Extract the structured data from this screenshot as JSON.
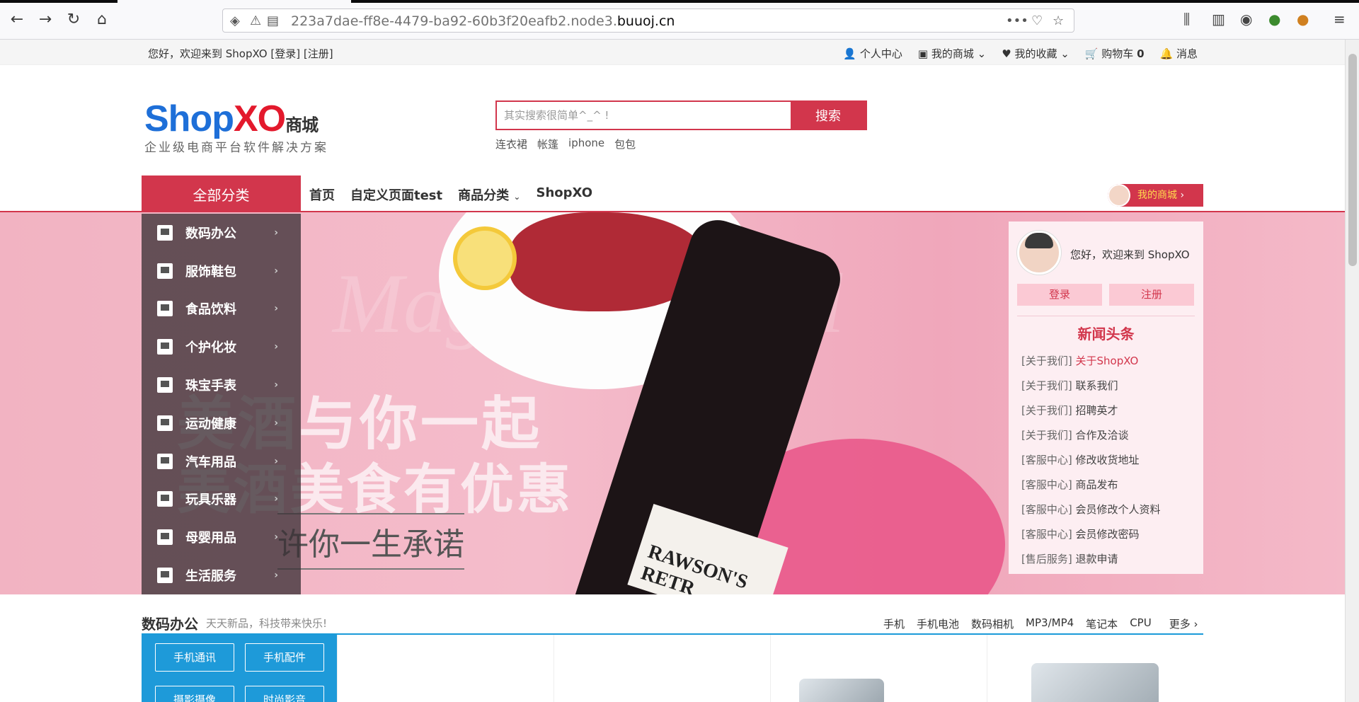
{
  "browser": {
    "url_prefix": "223a7dae-ff8e-4479-ba92-60b3f20eafb2.node3.",
    "url_domain": "buuoj.cn"
  },
  "topbar": {
    "welcome": "您好，欢迎来到 ShopXO [登录] [注册]",
    "personal": "个人中心",
    "my_mall": "我的商城",
    "favorites": "我的收藏",
    "cart": "购物车",
    "cart_count": "0",
    "messages": "消息"
  },
  "logo": {
    "shop": "Shop",
    "xo": "XO",
    "mall": "商城",
    "slogan": "企业级电商平台软件解决方案"
  },
  "search": {
    "placeholder": "其实搜索很简单^_^ !",
    "button": "搜索",
    "hot_words": [
      "连衣裙",
      "帐篷",
      "iphone",
      "包包"
    ]
  },
  "nav": {
    "all_categories": "全部分类",
    "items": [
      "首页",
      "自定义页面test",
      "商品分类",
      "ShopXO"
    ],
    "my_mall_button": "我的商城"
  },
  "categories": [
    "数码办公",
    "服饰鞋包",
    "食品饮料",
    "个护化妆",
    "珠宝手表",
    "运动健康",
    "汽车用品",
    "玩具乐器",
    "母婴用品",
    "生活服务"
  ],
  "banner": {
    "line1": "美酒与你一起",
    "line2": "美酒美食有优惠",
    "line3": "许你一生承诺",
    "bg_text": "Magic Festival",
    "label": "RAWSON'S RETR"
  },
  "user_panel": {
    "welcome": "您好，欢迎来到 ShopXO",
    "login": "登录",
    "register": "注册",
    "news_title": "新闻头条",
    "news": [
      {
        "cat": "[关于我们]",
        "title": "关于ShopXO"
      },
      {
        "cat": "[关于我们]",
        "title": "联系我们"
      },
      {
        "cat": "[关于我们]",
        "title": "招聘英才"
      },
      {
        "cat": "[关于我们]",
        "title": "合作及洽谈"
      },
      {
        "cat": "[客服中心]",
        "title": "修改收货地址"
      },
      {
        "cat": "[客服中心]",
        "title": "商品发布"
      },
      {
        "cat": "[客服中心]",
        "title": "会员修改个人资料"
      },
      {
        "cat": "[客服中心]",
        "title": "会员修改密码"
      },
      {
        "cat": "[售后服务]",
        "title": "退款申请"
      }
    ]
  },
  "floor": {
    "title": "数码办公",
    "subtitle": "天天新品，科技带来快乐!",
    "links": [
      "手机",
      "手机电池",
      "数码相机",
      "MP3/MP4",
      "笔记本",
      "CPU"
    ],
    "more": "更多",
    "tags": [
      "手机通讯",
      "手机配件",
      "摄影摄像",
      "时尚影音"
    ]
  },
  "colors": {
    "accent": "#d2364c",
    "floor_blue": "#1e9ad9"
  }
}
